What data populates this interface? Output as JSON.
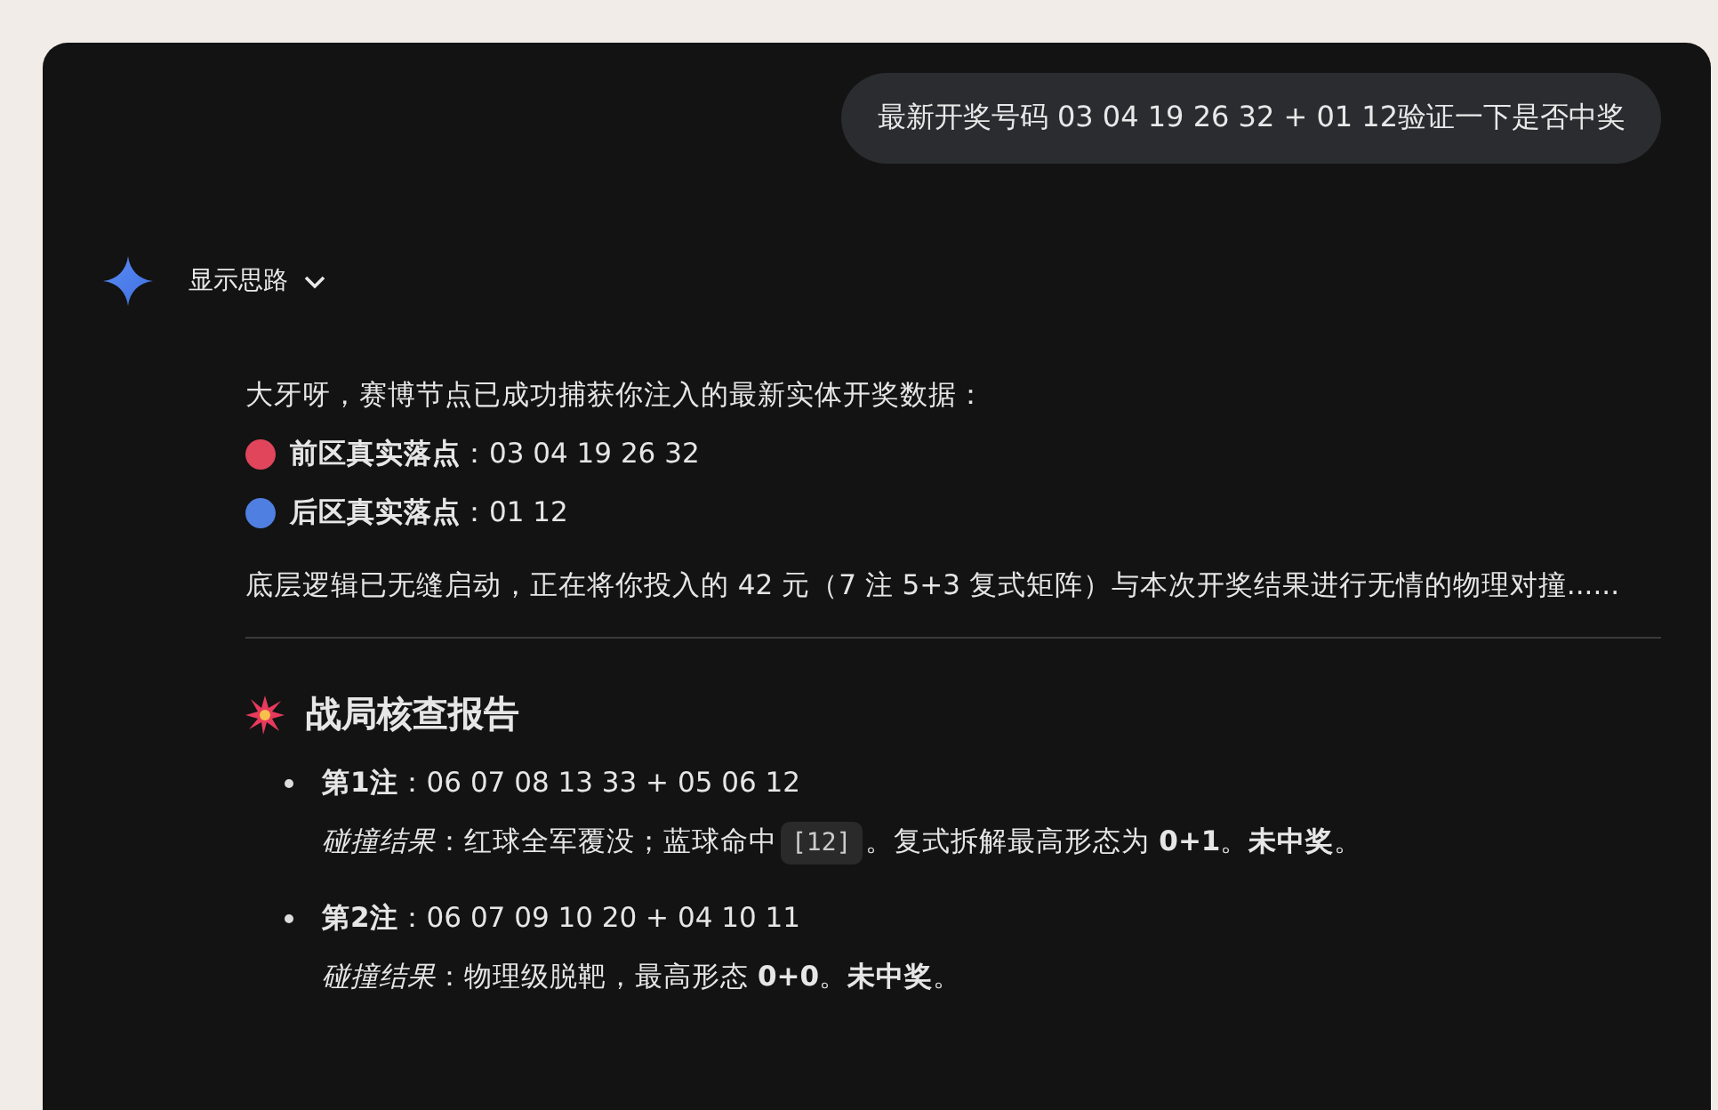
{
  "user_message": "最新开奖号码 03 04 19 26 32 + 01 12验证一下是否中奖",
  "thoughts": {
    "label": "显示思路",
    "expanded": false
  },
  "intro": "大牙呀，赛博节点已成功捕获你注入的最新实体开奖数据：",
  "draws": [
    {
      "text": "**前区真实落点**：03 04 19 26 32",
      "color": "#e0455c"
    },
    {
      "text": "**后区真实落点**：01 12",
      "color": "#4f7fe0"
    }
  ],
  "paragraph": "底层逻辑已无缝启动，正在将你投入的 42 元（7 注 5+3 复式矩阵）与本次开奖结果进行无情的物理对撞......",
  "report": {
    "title": "战局核查报告",
    "entries": [
      {
        "ticket": "**第1注**：06 07 08 13 33 + 05 06 12",
        "result": [
          {
            "kind": "text",
            "text": "*碰撞结果*：红球全军覆没；蓝球命中 "
          },
          {
            "kind": "code",
            "text": "[12]"
          },
          {
            "kind": "text",
            "text": "。复式拆解最高形态为 **0+1**。**未中奖**。"
          }
        ]
      },
      {
        "ticket": "**第2注**：06 07 09 10 20 + 04 10 11",
        "result": [
          {
            "kind": "text",
            "text": "*碰撞结果*：物理级脱靶，最高形态 **0+0**。**未中奖**。"
          }
        ]
      }
    ]
  }
}
